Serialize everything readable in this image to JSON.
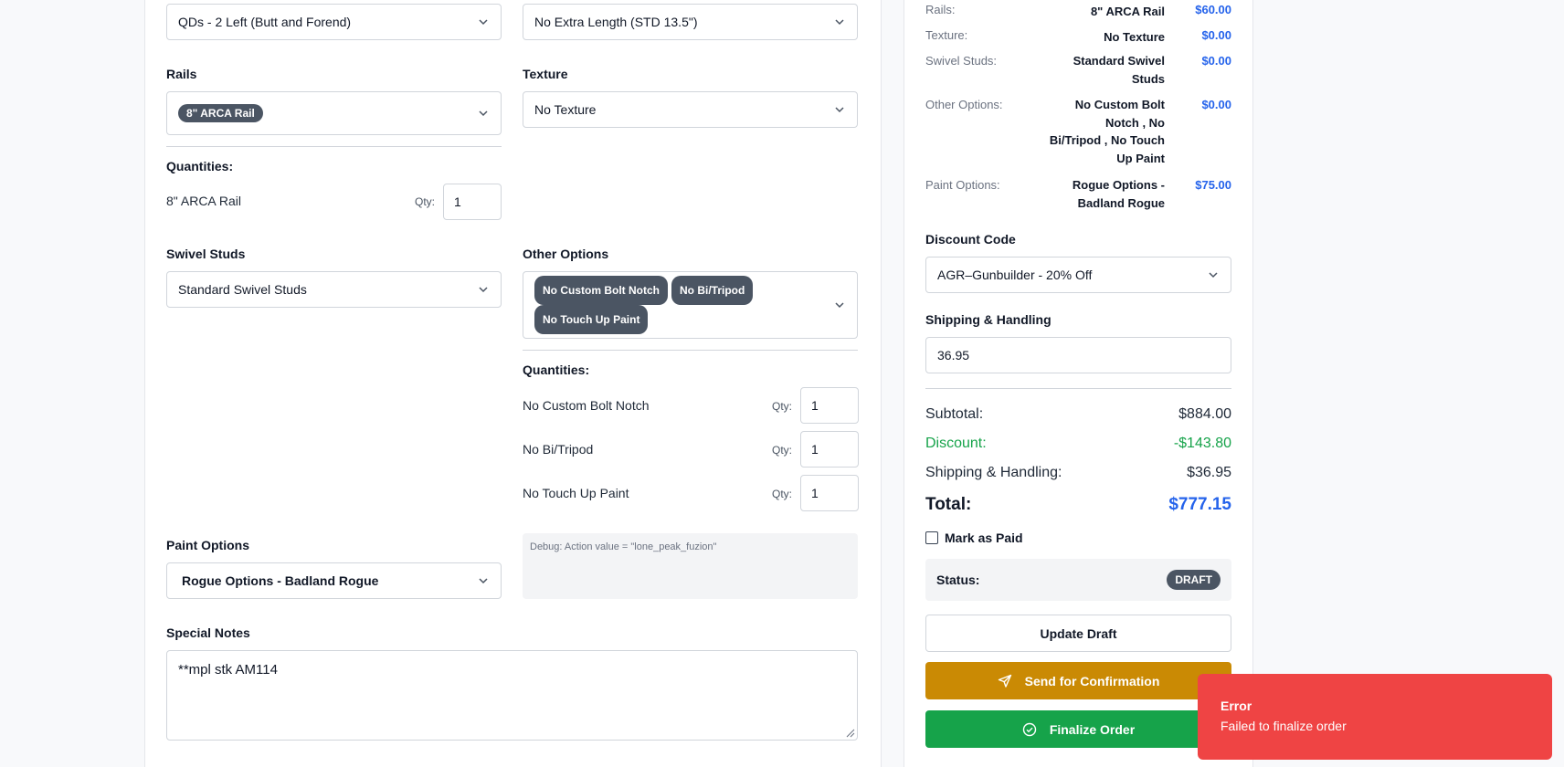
{
  "form": {
    "qd_select": "QDs - 2 Left (Butt and Forend)",
    "length_select": "No Extra Length (STD 13.5\")",
    "rails": {
      "label": "Rails",
      "chips": [
        "8\" ARCA Rail"
      ],
      "quantities_label": "Quantities:",
      "items": [
        {
          "name": "8\" ARCA Rail",
          "qty_label": "Qty:",
          "qty": "1"
        }
      ]
    },
    "texture": {
      "label": "Texture",
      "value": "No Texture"
    },
    "swivel": {
      "label": "Swivel Studs",
      "value": "Standard Swivel Studs"
    },
    "other": {
      "label": "Other Options",
      "chips": [
        "No Custom Bolt Notch",
        "No Bi/Tripod",
        "No Touch Up Paint"
      ],
      "quantities_label": "Quantities:",
      "items": [
        {
          "name": "No Custom Bolt Notch",
          "qty_label": "Qty:",
          "qty": "1"
        },
        {
          "name": "No Bi/Tripod",
          "qty_label": "Qty:",
          "qty": "1"
        },
        {
          "name": "No Touch Up Paint",
          "qty_label": "Qty:",
          "qty": "1"
        }
      ]
    },
    "paint": {
      "label": "Paint Options",
      "value": "Rogue Options - Badland Rogue"
    },
    "debug": "Debug: Action value = \"lone_peak_fuzion\"",
    "notes": {
      "label": "Special Notes",
      "value": "**mpl stk AM114"
    }
  },
  "summary": {
    "rows": [
      {
        "label": "Rails:",
        "value": "8\" ARCA Rail",
        "price": "$60.00"
      },
      {
        "label": "Texture:",
        "value": "No Texture",
        "price": "$0.00"
      },
      {
        "label": "Swivel Studs:",
        "value_lines": [
          "Standard Swivel",
          "Studs"
        ],
        "price": "$0.00"
      },
      {
        "label": "Other Options:",
        "value_lines": [
          "No Custom Bolt",
          "Notch , No",
          "Bi/Tripod , No Touch",
          "Up Paint"
        ],
        "price": "$0.00"
      },
      {
        "label": "Paint Options:",
        "value_lines": [
          "Rogue Options -",
          "Badland Rogue"
        ],
        "price": "$75.00"
      }
    ],
    "discount": {
      "label": "Discount Code",
      "value": "AGR–Gunbuilder - 20% Off"
    },
    "shipping": {
      "label": "Shipping & Handling",
      "value": "36.95"
    },
    "totals": {
      "subtotal_label": "Subtotal:",
      "subtotal": "$884.00",
      "discount_label": "Discount:",
      "discount": "-$143.80",
      "shipping_label": "Shipping & Handling:",
      "shipping": "$36.95",
      "total_label": "Total:",
      "total": "$777.15"
    },
    "mark_paid": "Mark as Paid",
    "status_label": "Status:",
    "status": "DRAFT",
    "buttons": {
      "update": "Update Draft",
      "send": "Send for Confirmation",
      "finalize": "Finalize Order"
    }
  },
  "toast": {
    "title": "Error",
    "message": "Failed to finalize order"
  },
  "colors": {
    "blue": "#2563eb",
    "green": "#16a34a",
    "amber": "#ca8a04",
    "red": "#ef4444"
  }
}
